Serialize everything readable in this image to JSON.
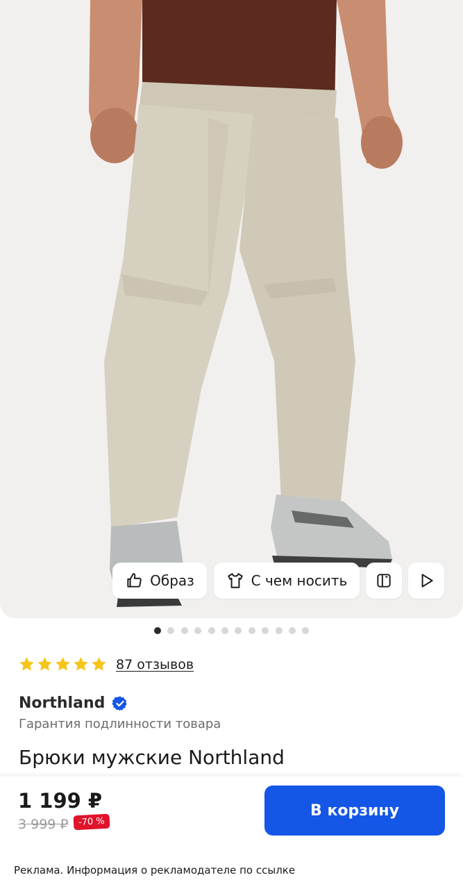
{
  "gallery": {
    "image_alt": "Men's beige trousers worn by a model",
    "actions": [
      {
        "label": "Образ",
        "icon": "thumbs-up-icon"
      },
      {
        "label": "С чем носить",
        "icon": "tshirt-icon"
      },
      {
        "label": "",
        "icon": "compare-icon"
      },
      {
        "label": "",
        "icon": "play-icon"
      }
    ],
    "dots_total": 12,
    "dot_active": 0
  },
  "rating": {
    "stars": 5,
    "reviews_label": "87 отзывов",
    "star_color": "#f5c518"
  },
  "brand": {
    "name": "Northland",
    "verified_color": "#1456e6",
    "guarantee": "Гарантия подлинности товара"
  },
  "product": {
    "title": "Брюки мужские Northland"
  },
  "buy_bar": {
    "price": "1 199 ₽",
    "old_price": "3 999 ₽",
    "discount": "-70 %",
    "cart_label": "В корзину",
    "accent": "#1456e6",
    "discount_color": "#e0132b"
  },
  "ad_note": "Реклама. Информация о рекламодателе по ссылке"
}
